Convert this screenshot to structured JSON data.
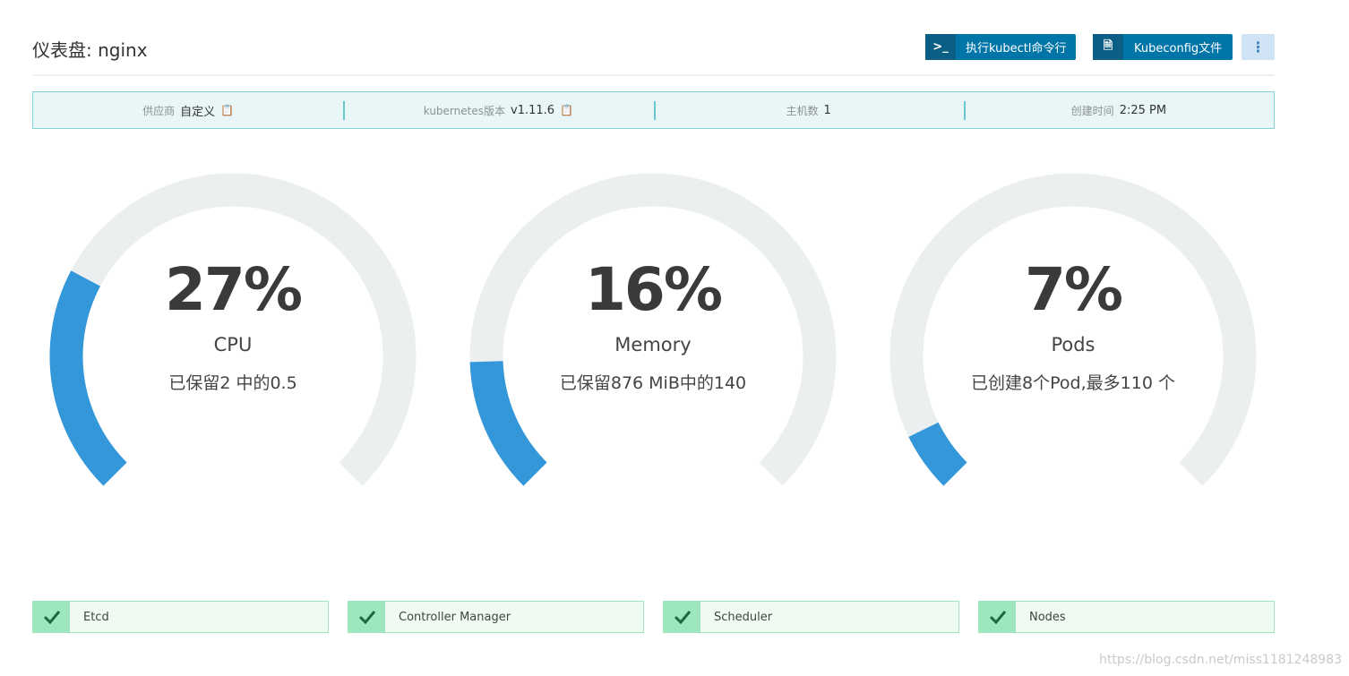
{
  "header": {
    "title": "仪表盘: nginx",
    "buttons": [
      {
        "label": "执行kubectl命令行",
        "icon": "terminal-icon"
      },
      {
        "label": "Kubeconfig文件",
        "icon": "file-icon"
      }
    ],
    "more_icon": "more-vertical-icon"
  },
  "info": [
    {
      "key": "供应商",
      "value": "自定义",
      "copy": true
    },
    {
      "key": "kubernetes版本",
      "value": "v1.11.6",
      "copy": true
    },
    {
      "key": "主机数",
      "value": "1"
    },
    {
      "key": "创建时间",
      "value": "2:25 PM"
    }
  ],
  "colors": {
    "fill": "#3497da",
    "track": "#ebeff0",
    "ok": "#9ee6bd"
  },
  "gauges": [
    {
      "percent_text": "27%",
      "percent": 27,
      "label": "CPU",
      "sub": "已保留2 中的0.5"
    },
    {
      "percent_text": "16%",
      "percent": 16,
      "label": "Memory",
      "sub": "已保留876 MiB中的140"
    },
    {
      "percent_text": "7%",
      "percent": 7,
      "label": "Pods",
      "sub": "已创建8个Pod,最多110 个"
    }
  ],
  "status": [
    {
      "label": "Etcd"
    },
    {
      "label": "Controller Manager"
    },
    {
      "label": "Scheduler"
    },
    {
      "label": "Nodes"
    }
  ],
  "watermark": "https://blog.csdn.net/miss1181248983"
}
